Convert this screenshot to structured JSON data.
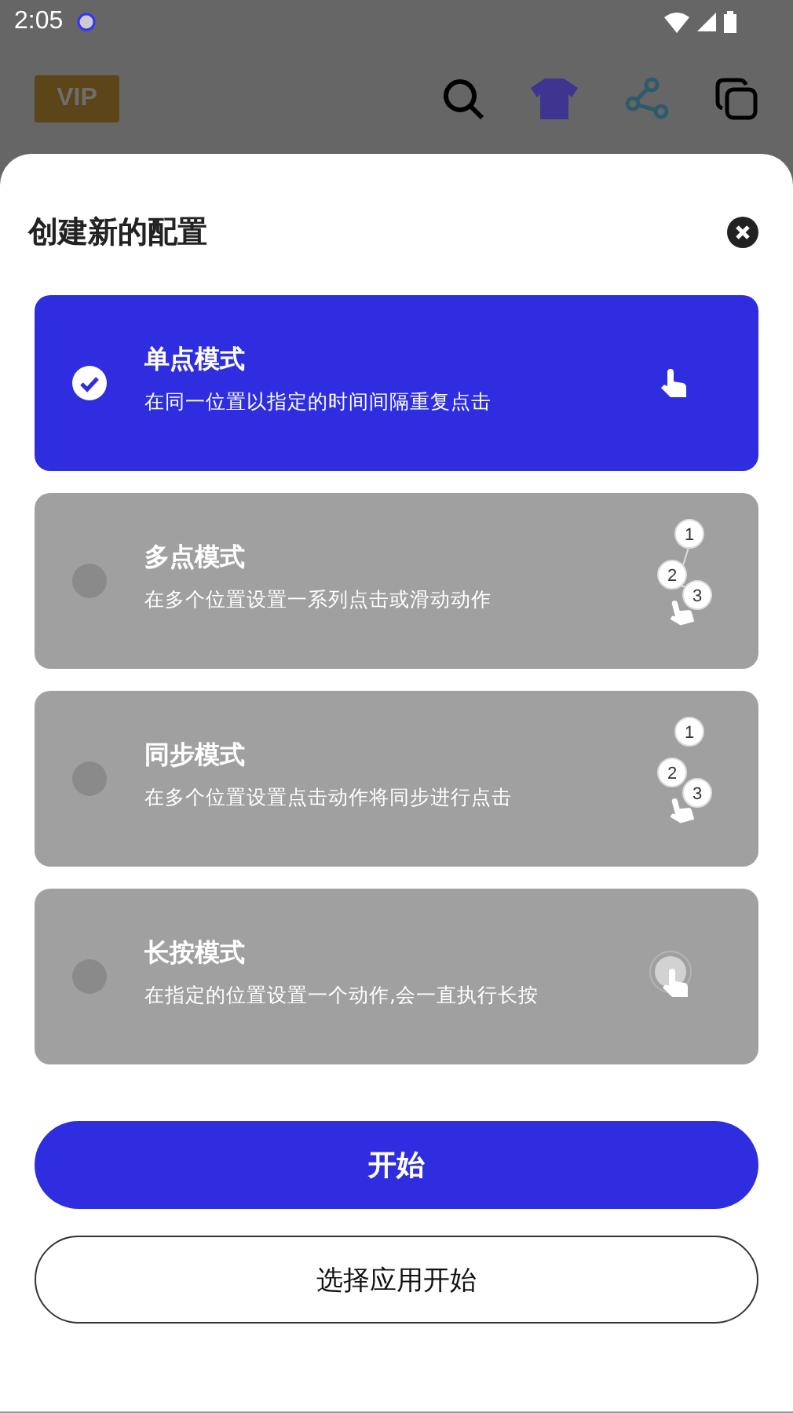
{
  "status_bar": {
    "time": "2:05"
  },
  "app_bar": {
    "vip": "VIP"
  },
  "sheet": {
    "title": "创建新的配置",
    "modes": [
      {
        "title": "单点模式",
        "description": "在同一位置以指定的时间间隔重复点击",
        "selected": true,
        "kind": "single"
      },
      {
        "title": "多点模式",
        "description": "在多个位置设置一系列点击或滑动动作",
        "selected": false,
        "kind": "multi",
        "steps": [
          "1",
          "2",
          "3"
        ]
      },
      {
        "title": "同步模式",
        "description": "在多个位置设置点击动作将同步进行点击",
        "selected": false,
        "kind": "sync",
        "steps": [
          "1",
          "2",
          "3"
        ]
      },
      {
        "title": "长按模式",
        "description": "在指定的位置设置一个动作,会一直执行长按",
        "selected": false,
        "kind": "long"
      }
    ],
    "start_button": "开始",
    "choose_app_button": "选择应用开始"
  }
}
